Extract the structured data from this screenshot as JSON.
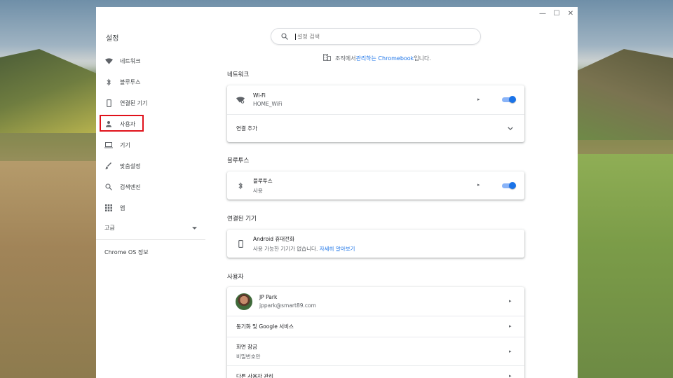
{
  "window": {
    "controls": [
      "minimize",
      "maximize",
      "close"
    ]
  },
  "sidebar": {
    "title": "설정",
    "items": [
      {
        "label": "네트워크",
        "icon": "wifi-icon"
      },
      {
        "label": "블루투스",
        "icon": "bluetooth-icon"
      },
      {
        "label": "연결된 기기",
        "icon": "phone-icon"
      },
      {
        "label": "사용자",
        "icon": "person-icon",
        "highlighted": true
      },
      {
        "label": "기기",
        "icon": "laptop-icon"
      },
      {
        "label": "맞춤설정",
        "icon": "brush-icon"
      },
      {
        "label": "검색엔진",
        "icon": "search-icon"
      },
      {
        "label": "앱",
        "icon": "apps-grid-icon"
      }
    ],
    "advanced": "고급",
    "about": "Chrome OS 정보"
  },
  "search": {
    "placeholder": "설정 검색"
  },
  "managed": {
    "prefix": "조직에서 ",
    "link": "관리하는 Chromebook",
    "suffix": "입니다."
  },
  "sections": {
    "network": {
      "title": "네트워크",
      "wifi": {
        "name": "Wi-Fi",
        "ssid": "HOME_WiFi",
        "enabled": true
      },
      "add_connection": "연결 추가"
    },
    "bluetooth": {
      "title": "블루투스",
      "label": "블루투스",
      "status": "사용",
      "enabled": true
    },
    "connected": {
      "title": "연결된 기기",
      "device": "Android 휴대전화",
      "desc": "사용 가능한 기기가 없습니다. ",
      "link": "자세히 알아보기"
    },
    "people": {
      "title": "사용자",
      "name": "JP Park",
      "email": "jppark@smart89.com",
      "sync": "동기화 및 Google 서비스",
      "lock_title": "화면 잠금",
      "lock_sub": "비밀번호만",
      "manage_others": "다른 사용자 관리"
    }
  },
  "colors": {
    "accent": "#1a73e8",
    "highlight_box": "#e0121b"
  }
}
